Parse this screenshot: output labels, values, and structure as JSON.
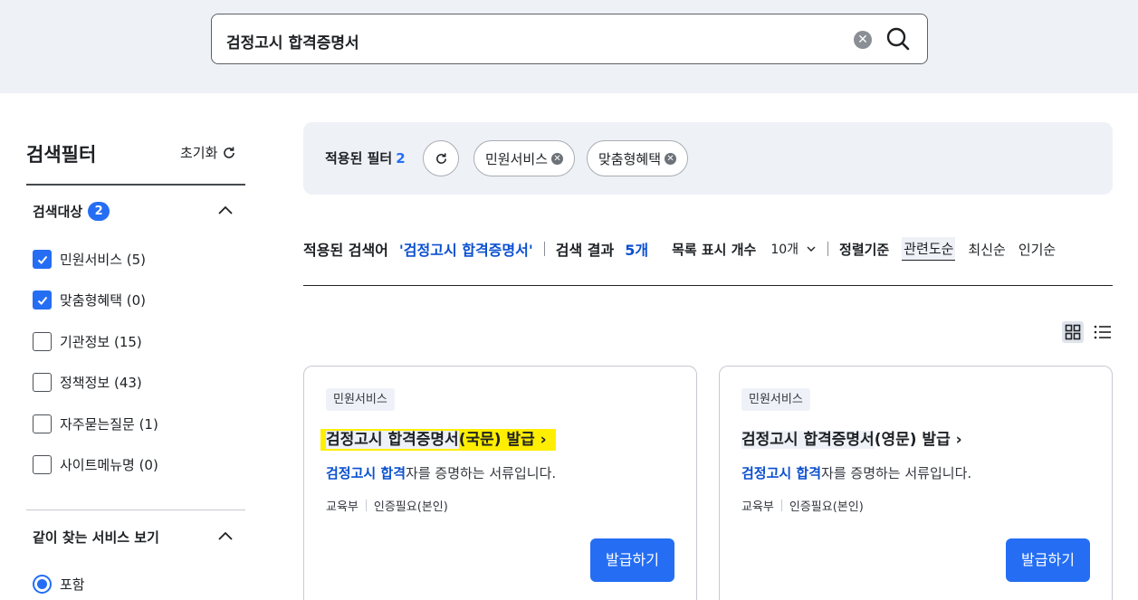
{
  "search": {
    "query": "검정고시 합격증명서"
  },
  "sidebar": {
    "title": "검색필터",
    "reset_label": "초기화",
    "target_section": {
      "title": "검색대상",
      "count": "2",
      "options": [
        {
          "label": "민원서비스 (5)",
          "checked": true
        },
        {
          "label": "맞춤형혜택 (0)",
          "checked": true
        },
        {
          "label": "기관정보 (15)",
          "checked": false
        },
        {
          "label": "정책정보 (43)",
          "checked": false
        },
        {
          "label": "자주묻는질문 (1)",
          "checked": false
        },
        {
          "label": "사이트메뉴명 (0)",
          "checked": false
        }
      ]
    },
    "related_section": {
      "title": "같이 찾는 서비스 보기",
      "radio_label": "포함"
    }
  },
  "applied_filters": {
    "label": "적용된 필터",
    "count": "2",
    "chips": [
      "민원서비스",
      "맞춤형혜택"
    ]
  },
  "summary": {
    "applied_query_label": "적용된 검색어",
    "applied_query": "'검정고시 합격증명서'",
    "result_label": "검색 결과",
    "result_count": "5개",
    "page_size_label": "목록 표시 개수",
    "page_size_value": "10개",
    "sort_label": "정렬기준",
    "sort_options": [
      "관련도순",
      "최신순",
      "인기순"
    ]
  },
  "cards": [
    {
      "tag": "민원서비스",
      "title_hl": "검정고시 합격증명서",
      "title_rest": "(국문) 발급",
      "desc_hl": "검정고시 합격",
      "desc_rest": "자를 증명하는 서류입니다.",
      "agency": "교육부",
      "auth": "인증필요(본인)",
      "button": "발급하기"
    },
    {
      "tag": "민원서비스",
      "title_hl": "검정고시 합격증명서",
      "title_rest": "(영문) 발급",
      "desc_hl": "검정고시 합격",
      "desc_rest": "자를 증명하는 서류입니다.",
      "agency": "교육부",
      "auth": "인증필요(본인)",
      "button": "발급하기"
    }
  ],
  "colors": {
    "primary": "#256ef4",
    "highlight_yellow": "#ffee00",
    "band": "#eef1f6"
  }
}
